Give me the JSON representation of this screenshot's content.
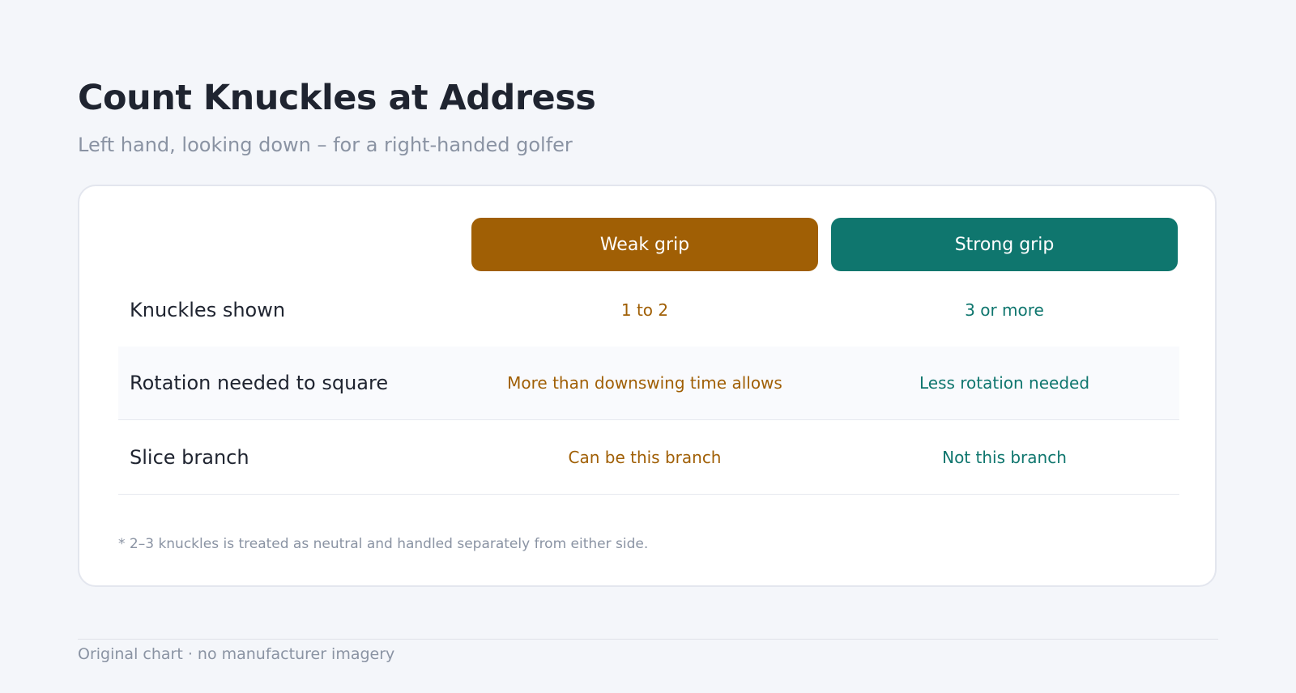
{
  "title": "Count Knuckles at Address",
  "subtitle": "Left hand, looking down – for a right-handed golfer",
  "table": {
    "columns": [
      "Weak grip",
      "Strong grip"
    ],
    "rows": [
      {
        "label": "Knuckles shown",
        "weak": "1 to 2",
        "strong": "3 or more"
      },
      {
        "label": "Rotation needed to square",
        "weak": "More than downswing time allows",
        "strong": "Less rotation needed"
      },
      {
        "label": "Slice branch",
        "weak": "Can be this branch",
        "strong": "Not this branch"
      }
    ],
    "note": "* 2–3 knuckles is treated as neutral and handled separately from either side."
  },
  "footer": "Original chart · no manufacturer imagery",
  "colors": {
    "weak": "#a05f05",
    "strong": "#0f766e",
    "background": "#f4f6fa"
  }
}
